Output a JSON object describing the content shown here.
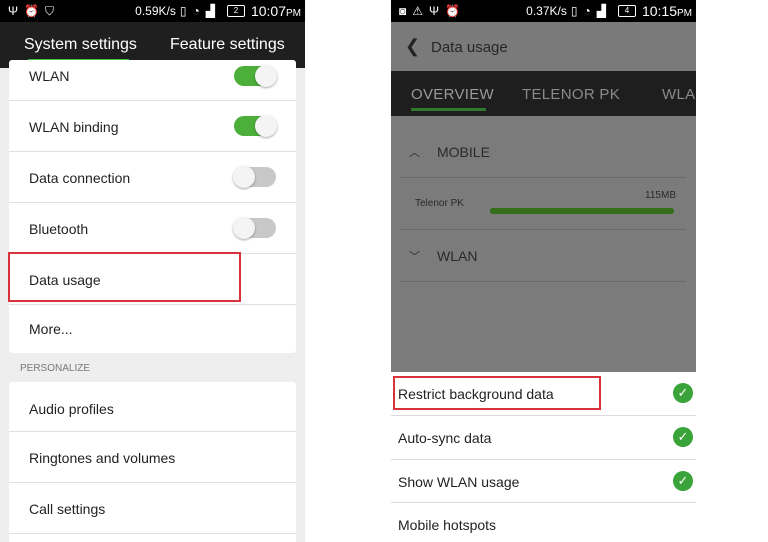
{
  "left": {
    "status_bar": {
      "icons": [
        "usb-icon",
        "alarm-icon",
        "shield-icon"
      ],
      "speed": "0.59K/s",
      "battery": "2",
      "time": "10:07",
      "ampm": "PM"
    },
    "tabs": [
      {
        "label": "System settings",
        "active": true
      },
      {
        "label": "Feature settings",
        "active": false
      }
    ],
    "items": [
      {
        "label": "WLAN",
        "toggle": "on"
      },
      {
        "label": "WLAN binding",
        "toggle": "on"
      },
      {
        "label": "Data connection",
        "toggle": "off"
      },
      {
        "label": "Bluetooth",
        "toggle": "off"
      },
      {
        "label": "Data usage"
      },
      {
        "label": "More..."
      }
    ],
    "section_personalize": "PERSONALIZE",
    "personalize_items": [
      {
        "label": "Audio profiles"
      },
      {
        "label": "Ringtones and volumes"
      },
      {
        "label": "Call settings"
      }
    ],
    "highlight_color": "#d8323b",
    "accent_color": "#3fbf43"
  },
  "right": {
    "status_bar": {
      "icons": [
        "media-icon",
        "warning-icon",
        "usb-icon",
        "alarm-icon"
      ],
      "speed": "0.37K/s",
      "battery": "4",
      "time": "10:15",
      "ampm": "PM"
    },
    "title": "Data usage",
    "tabs": [
      "OVERVIEW",
      "TELENOR PK",
      "WLA"
    ],
    "groups": {
      "mobile": {
        "label": "MOBILE",
        "carrier": "Telenor PK",
        "size": "115MB",
        "progress": 1.0
      },
      "wlan": {
        "label": "WLAN"
      }
    },
    "menu": [
      {
        "label": "Restrict background data",
        "checked": true
      },
      {
        "label": "Auto-sync data",
        "checked": true
      },
      {
        "label": "Show WLAN usage",
        "checked": true
      },
      {
        "label": "Mobile hotspots",
        "checked": false
      }
    ],
    "check_color": "#3aa33a"
  }
}
